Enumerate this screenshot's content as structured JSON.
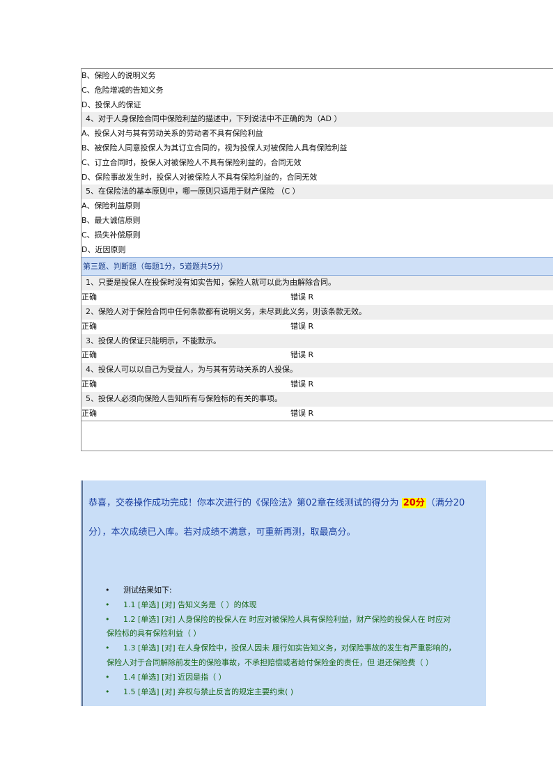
{
  "quiz": {
    "opts_top": [
      "B、保险人的说明义务",
      "C、危险增减的告知义务",
      "D、投保人的保证"
    ],
    "q4": "4、对于人身保险合同中保险利益的描述中，下列说法中不正确的为（AD ）",
    "q4_opts": [
      "A、投保人对与其有劳动关系的劳动者不具有保险利益",
      "B、被保险人同意投保人为其订立合同的，视为投保人对被保险人具有保险利益",
      "C、订立合同时，投保人对被保险人不具有保险利益的，合同无效",
      "D、保险事故发生时，投保人对被保险人不具有保险利益的，合同无效"
    ],
    "q5": "5、在保险法的基本原则中，哪一原则只适用于财产保险 （C ）",
    "q5_opts": [
      "A、保险利益原则",
      "B、最大诚信原则",
      "C、损失补偿原则",
      "D、近因原则"
    ],
    "section3": "第三题、判断题（每题1分，5道题共5分）",
    "tf_true": "正确",
    "tf_false": "错误 R",
    "tf": [
      "1、只要是投保人在投保时没有如实告知，保险人就可以此为由解除合同。",
      "2、保险人对于保险合同中任何条款都有说明义务，未尽到此义务，则该条款无效。",
      "3、投保人的保证只能明示，不能默示。",
      "4、投保人可以以自己为受益人，为与其有劳动关系的人投保。",
      "5、投保人必须向保险人告知所有与保险标的有关的事项。"
    ]
  },
  "result": {
    "line1_pre": "恭喜，交卷操作成功完成！你本次进行的《保险法》第02章在线测试的得分为 ",
    "score": "20分",
    "line1_post": "（满分20",
    "line2": "分），本次成绩已入库。若对成绩不满意，可重新再测，取最高分。",
    "list_head": "测试结果如下:",
    "items": [
      "1.1 [单选] [对] 告知义务是（ ）的体现",
      "1.2 [单选] [对] 人身保险的投保人在 时应对被保险人具有保险利益，财产保险的投保人在 时应对",
      "1.3 [单选] [对] 在人身保险中，投保人因未 履行如实告知义务，对保险事故的发生有严重影响的，",
      "1.4 [单选] [对] 近因是指（ ）",
      "1.5 [单选] [对] 弃权与禁止反言的规定主要约束( )"
    ],
    "item2_cont": "保险标的具有保险利益（ ）",
    "item3_cont": "保险人对于合同解除前发生的保险事故，不承担赔偿或者给付保险金的责任，但 退还保险费（ ）",
    "bullet": "•"
  }
}
